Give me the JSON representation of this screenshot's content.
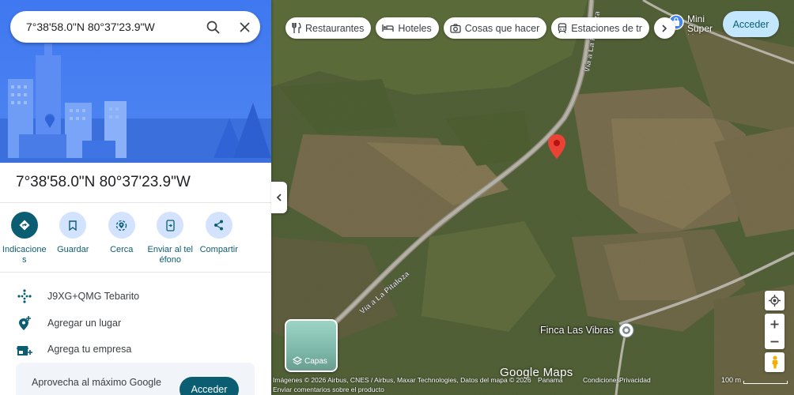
{
  "search": {
    "query": "7°38'58.0\"N 80°37'23.9\"W"
  },
  "place": {
    "title": "7°38'58.0\"N 80°37'23.9\"W",
    "actions": [
      {
        "label": "Indicaciones",
        "icon": "directions-icon"
      },
      {
        "label": "Guardar",
        "icon": "bookmark-icon"
      },
      {
        "label": "Cerca",
        "icon": "nearby-icon"
      },
      {
        "label": "Enviar al teléfono",
        "icon": "send-to-phone-icon"
      },
      {
        "label": "Compartir",
        "icon": "share-icon"
      }
    ],
    "info_rows": [
      {
        "text": "J9XG+QMG Tebarito",
        "icon": "plus-code-icon"
      },
      {
        "text": "Agregar un lugar",
        "icon": "add-place-icon"
      },
      {
        "text": "Agrega tu empresa",
        "icon": "add-business-icon"
      }
    ],
    "promo": {
      "text": "Aprovecha al máximo Google",
      "button": "Acceder"
    }
  },
  "map": {
    "chips": [
      {
        "label": "Restaurantes",
        "icon": "restaurant-icon"
      },
      {
        "label": "Hoteles",
        "icon": "hotel-icon"
      },
      {
        "label": "Cosas que hacer",
        "icon": "camera-icon"
      },
      {
        "label": "Estaciones de tr",
        "icon": "transit-icon"
      }
    ],
    "login_label": "Acceder",
    "layers_label": "Capas",
    "road_labels": [
      "Vía a La Pitaloza",
      "Vía a La Pitaloza"
    ],
    "poi_top": "Mini Super Hermanos",
    "poi_finca": "Finca Las Vibras",
    "attribution": "Imágenes © 2026 Airbus, CNES / Airbus, Maxar Technologies, Datos del mapa © 2026",
    "footer_links": [
      "Panamá",
      "Condiciones",
      "Privacidad"
    ],
    "feedback": "Enviar comentarios sobre el producto",
    "scale": "100 m",
    "logo": "Google Maps",
    "colors": {
      "accent": "#0b5e72",
      "pin": "#ea4335",
      "chip_bg": "#ffffff"
    }
  }
}
